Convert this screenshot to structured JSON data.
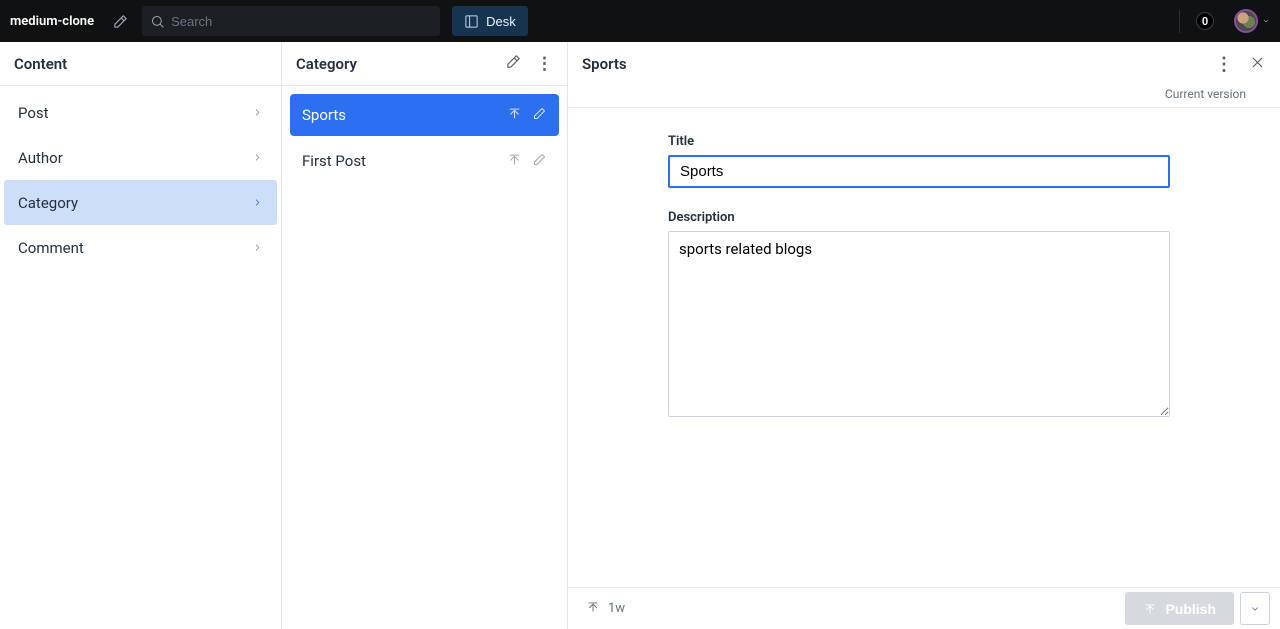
{
  "nav": {
    "brand": "medium-clone",
    "search_placeholder": "Search",
    "desk_label": "Desk",
    "badge_count": "0"
  },
  "sidebar": {
    "title": "Content",
    "items": [
      {
        "label": "Post",
        "selected": false
      },
      {
        "label": "Author",
        "selected": false
      },
      {
        "label": "Category",
        "selected": true
      },
      {
        "label": "Comment",
        "selected": false
      }
    ]
  },
  "list": {
    "title": "Category",
    "items": [
      {
        "label": "Sports",
        "selected": true
      },
      {
        "label": "First Post",
        "selected": false
      }
    ]
  },
  "editor": {
    "title": "Sports",
    "version_label": "Current version",
    "fields": {
      "title_label": "Title",
      "title_value": "Sports",
      "description_label": "Description",
      "description_value": "sports related blogs"
    },
    "footer": {
      "age": "1w",
      "publish_label": "Publish"
    }
  }
}
